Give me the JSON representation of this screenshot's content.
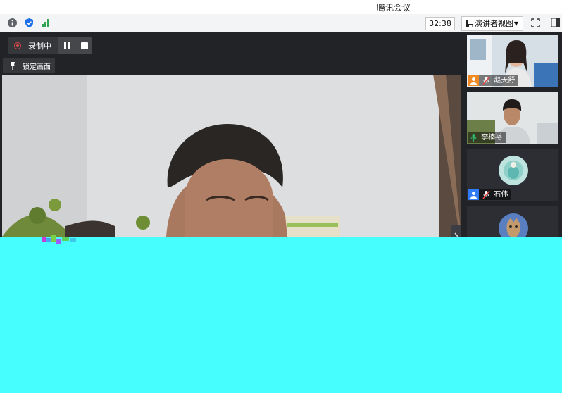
{
  "window": {
    "title": "腾讯会议"
  },
  "toolbar": {
    "info_icon": "info-icon",
    "security_icon": "shield-icon",
    "network_icon": "signal-bars-icon",
    "timer": "32:38",
    "view_mode": "演讲者视图",
    "fullscreen_icon": "fullscreen-icon",
    "sidebar_icon": "sidebar-toggle-icon"
  },
  "recording": {
    "status_label": "录制中",
    "pause_icon": "pause-icon",
    "stop_icon": "stop-icon"
  },
  "lock_screen": {
    "label": "锁定画面",
    "icon": "pin-icon"
  },
  "participants": [
    {
      "name": "赵天舒",
      "mic": "muted",
      "role_icon": "host-badge-icon"
    },
    {
      "name": "李楠裕",
      "mic": "speaking"
    },
    {
      "name": "石伟",
      "mic": "muted",
      "role_icon": "user-badge-icon"
    },
    {
      "name": "",
      "mic": ""
    }
  ],
  "colors": {
    "toolbar_bg": "#f3f4f6",
    "stage_bg": "#212327",
    "recording_red": "#e64848",
    "speaking_green": "#31b26a",
    "host_orange": "#f08a24",
    "user_blue": "#2f7cf6",
    "overlay_cyan": "#46fefe"
  }
}
